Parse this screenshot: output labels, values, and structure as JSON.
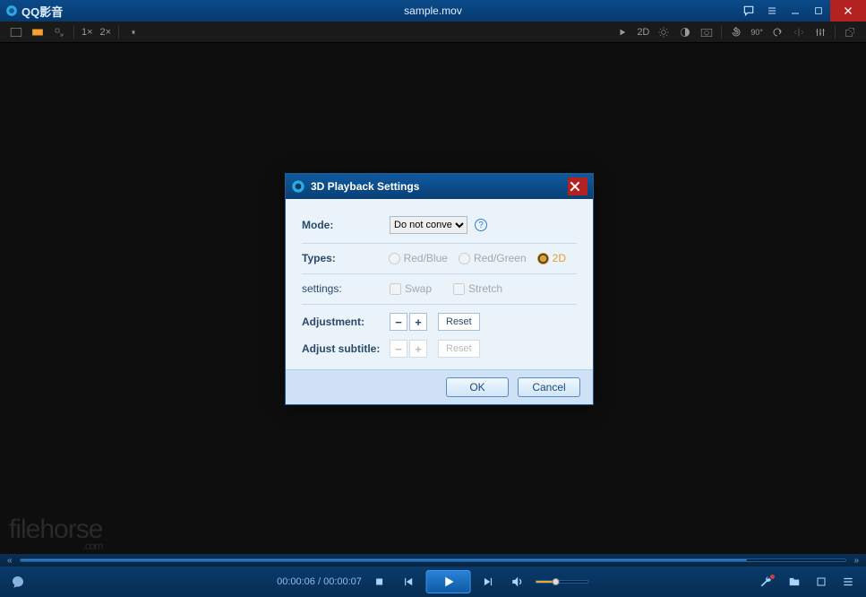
{
  "app": {
    "name": "QQ影音",
    "file_title": "sample.mov"
  },
  "toolbar": {
    "left": {
      "fullscreen": "fullscreen",
      "compact": "compact",
      "ontop": "ontop",
      "speed_1x": "1×",
      "speed_2x": "2×",
      "pin": "pin"
    },
    "right": {
      "play_arrow": "▷",
      "mode_2d": "2D",
      "brightness": "brightness",
      "color": "color",
      "snapshot": "snapshot",
      "rotate_left": "↺",
      "rotate_90": "90°",
      "flip": "flip",
      "eq": "eq",
      "popout": "popout"
    }
  },
  "playback": {
    "current": "00:00:06",
    "total": "00:00:07",
    "separator": " / "
  },
  "dialog": {
    "title": "3D Playback Settings",
    "mode_label": "Mode:",
    "mode_options": [
      "Do not conve"
    ],
    "types_label": "Types:",
    "type_redblue": "Red/Blue",
    "type_redgreen": "Red/Green",
    "type_2d": "2D",
    "settings_label": "settings:",
    "swap": "Swap",
    "stretch": "Stretch",
    "adjustment_label": "Adjustment:",
    "adjust_subtitle_label": "Adjust subtitle:",
    "minus": "−",
    "plus": "+",
    "reset": "Reset",
    "ok": "OK",
    "cancel": "Cancel",
    "help": "?"
  },
  "watermark": {
    "name": "filehorse",
    "suffix": ".com"
  }
}
